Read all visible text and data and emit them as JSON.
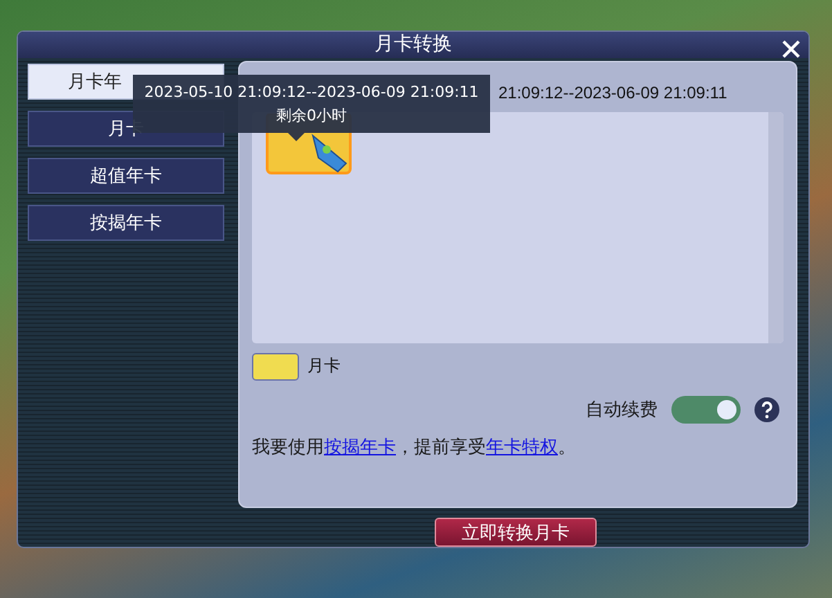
{
  "window": {
    "title": "月卡转换"
  },
  "tabs": [
    {
      "label": "月卡年",
      "selected": true
    },
    {
      "label": "月卡",
      "selected": false
    },
    {
      "label": "超值年卡",
      "selected": false
    },
    {
      "label": "按揭年卡",
      "selected": false
    }
  ],
  "period_text": "21:09:12--2023-06-09 21:09:11",
  "legend": [
    {
      "label": "月卡",
      "color": "#f0dc50"
    }
  ],
  "auto_renew": {
    "label": "自动续费",
    "on": true
  },
  "notice": [
    {
      "kind": "text",
      "text": "我要使用"
    },
    {
      "kind": "link",
      "text": "按揭年卡"
    },
    {
      "kind": "text",
      "text": "，提前享受"
    },
    {
      "kind": "link",
      "text": "年卡特权"
    },
    {
      "kind": "text",
      "text": "。"
    }
  ],
  "convert_button": "立即转换月卡",
  "tooltip": {
    "lines": [
      "2023-05-10 21:09:12--2023-06-09 21:09:11",
      "剩余0小时"
    ]
  }
}
